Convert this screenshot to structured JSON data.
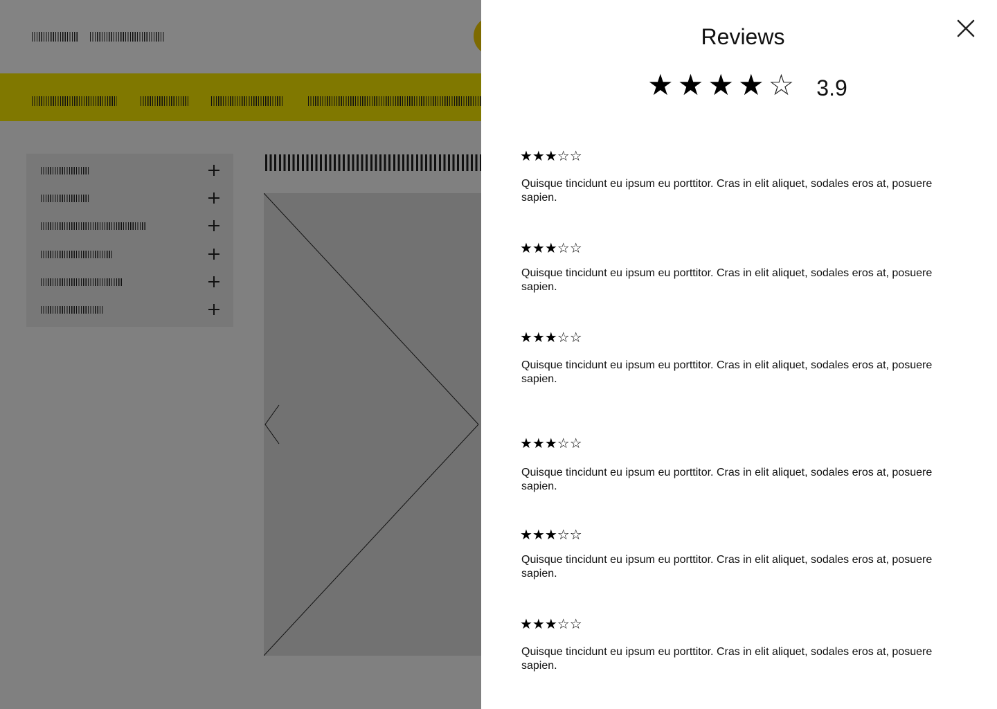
{
  "modal": {
    "title": "Reviews",
    "rating_stars": [
      "filled",
      "filled",
      "filled",
      "filled",
      "empty"
    ],
    "average_score": "3.9",
    "close_icon": "close-icon"
  },
  "reviews": [
    {
      "stars": "★★★☆☆",
      "text": "Quisque tincidunt eu ipsum eu porttitor. Cras in elit aliquet, sodales eros at, posuere sapien."
    },
    {
      "stars": "★★★☆☆",
      "text": "Quisque tincidunt eu ipsum eu porttitor. Cras in elit aliquet, sodales eros at, posuere sapien."
    },
    {
      "stars": "★★★☆☆",
      "text": "Quisque tincidunt eu ipsum eu porttitor. Cras in elit aliquet, sodales eros at, posuere sapien."
    },
    {
      "stars": "★★★☆☆",
      "text": "Quisque tincidunt eu ipsum eu porttitor. Cras in elit aliquet, sodales eros at, posuere sapien."
    },
    {
      "stars": "★★★☆☆",
      "text": "Quisque tincidunt eu ipsum eu porttitor. Cras in elit aliquet, sodales eros at, posuere sapien."
    },
    {
      "stars": "★★★☆☆",
      "text": "Quisque tincidunt eu ipsum eu porttitor. Cras in elit aliquet, sodales eros at, posuere sapien."
    }
  ],
  "background": {
    "nav_item_count": 4,
    "side_menu_item_count": 6,
    "colors": {
      "overlay_gray": "#808080",
      "nav_bar": "#807800",
      "logo": "#7d6a00",
      "drawer": "#ffffff"
    }
  }
}
